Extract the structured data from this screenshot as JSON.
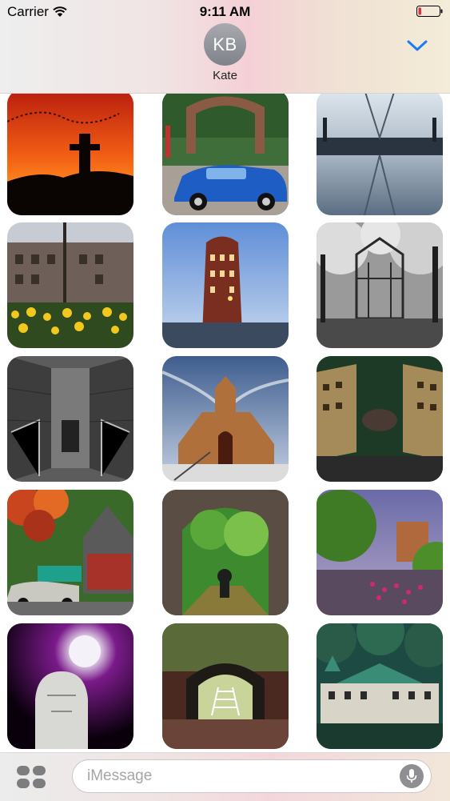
{
  "status_bar": {
    "carrier": "Carrier",
    "time": "9:11 AM",
    "icons": [
      "wifi-icon",
      "battery-icon"
    ],
    "battery_color": "#e0303a"
  },
  "conversation": {
    "avatar_initials": "KB",
    "contact_name": "Kate",
    "details_icon": "chevron-down-icon",
    "accent_color": "#1a7cf5"
  },
  "photos": [
    {
      "subject": "sunset-silhouette-statue"
    },
    {
      "subject": "basin-spring-arch-blue-car"
    },
    {
      "subject": "foggy-bridge-reflection"
    },
    {
      "subject": "hotel-daffodils"
    },
    {
      "subject": "flatiron-building-dusk"
    },
    {
      "subject": "forest-chapel-bw"
    },
    {
      "subject": "stone-stairway-bw"
    },
    {
      "subject": "stone-church-hdr"
    },
    {
      "subject": "mirrored-hotel-towers"
    },
    {
      "subject": "gingerbread-house-vintage-car"
    },
    {
      "subject": "tunnel-mountain-biker"
    },
    {
      "subject": "park-crowd-hotel"
    },
    {
      "subject": "moon-statue-head"
    },
    {
      "subject": "stone-tunnel-stairs"
    },
    {
      "subject": "victorian-hotel-forest"
    }
  ],
  "input_bar": {
    "placeholder": "iMessage",
    "apps_icon": "apps-icon",
    "mic_icon": "microphone-icon"
  }
}
